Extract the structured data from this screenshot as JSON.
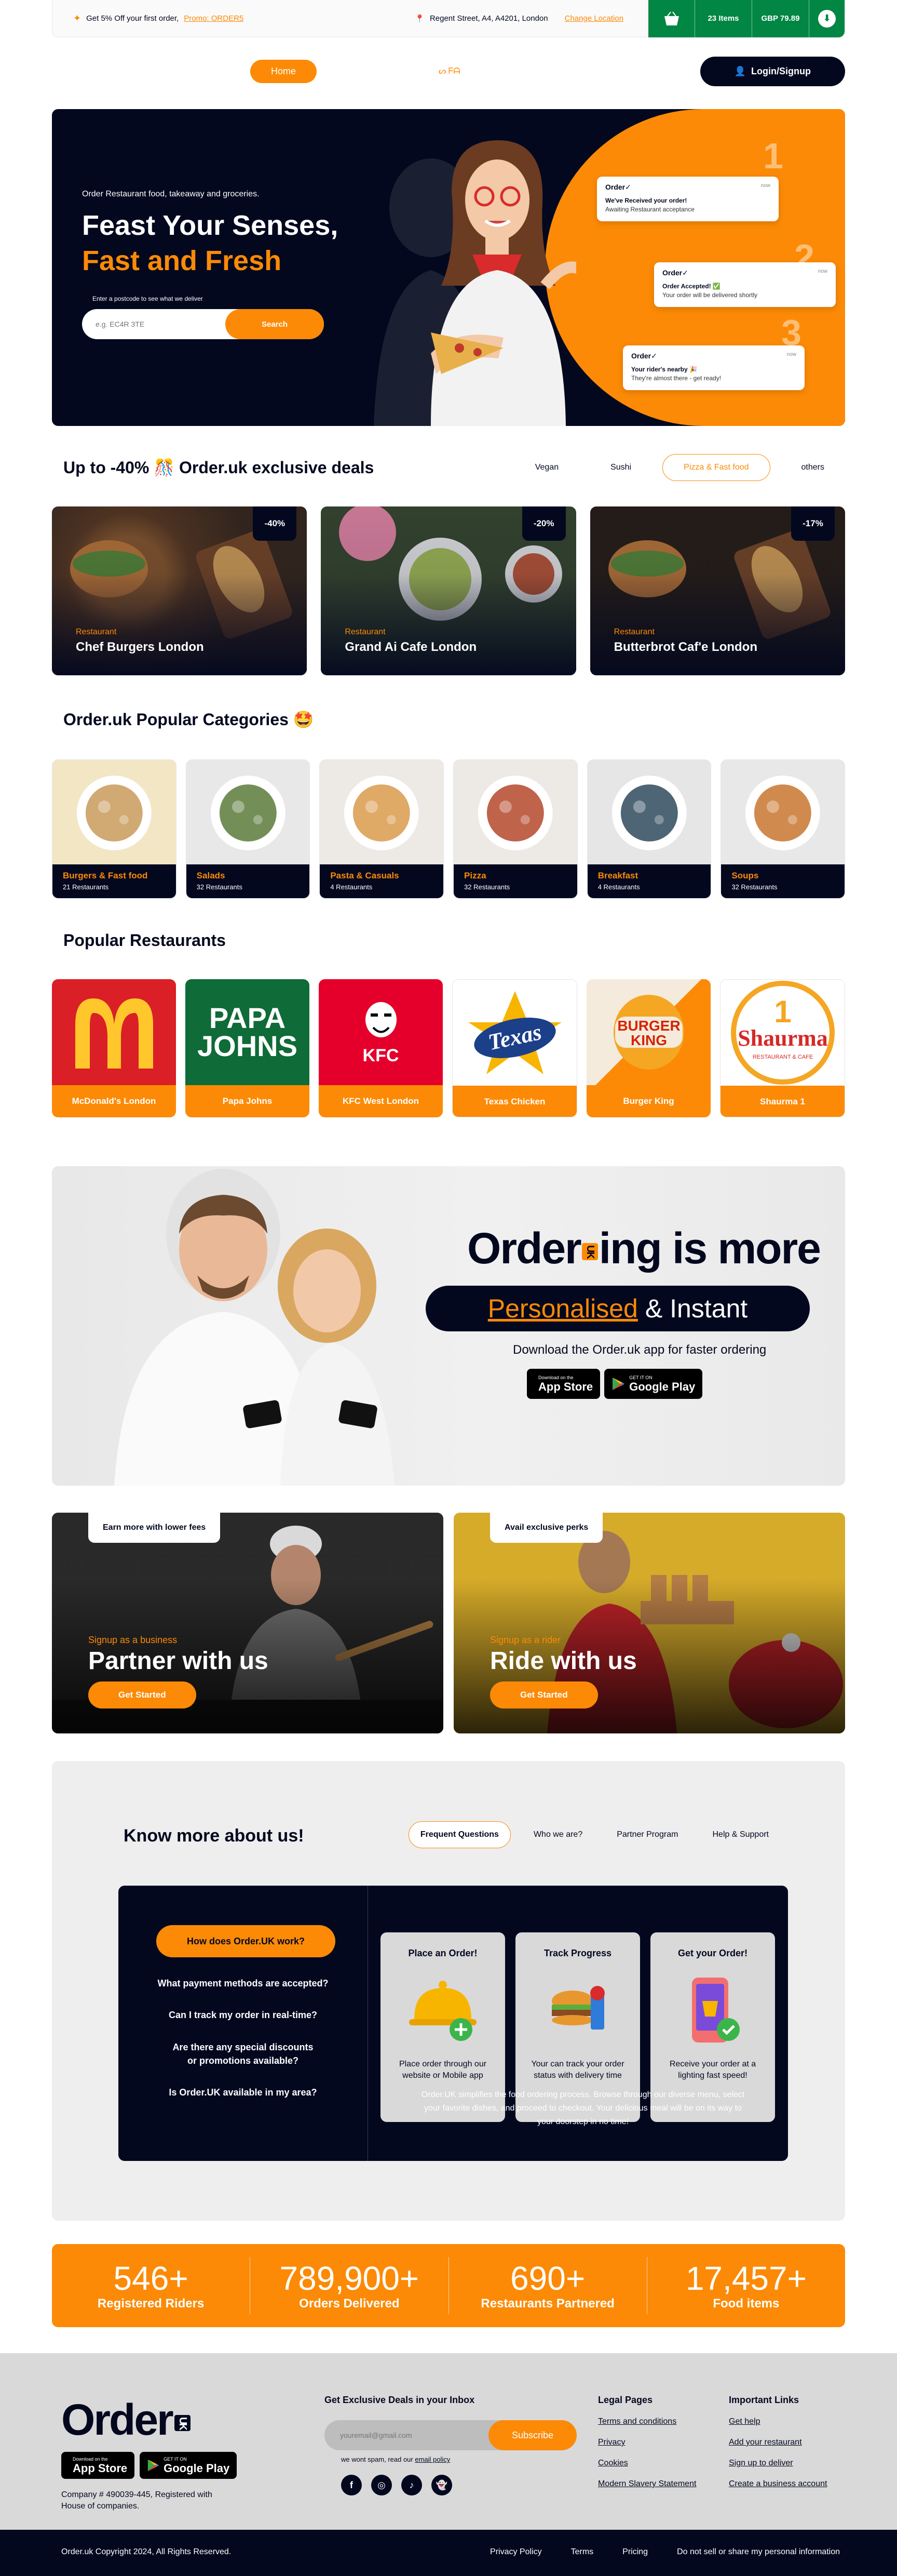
{
  "topbar": {
    "promo_prefix": "Get 5% Off your first order,",
    "promo_code": "Promo: ORDER5",
    "location": "Regent Street, A4, A4201, London",
    "change_location": "Change Location",
    "cart_items": "23 Items",
    "cart_total": "GBP 79.89"
  },
  "nav": {
    "home": "Home",
    "mid": "ᔕ ᖴᗩ",
    "login": "Login/Signup"
  },
  "hero": {
    "tagline": "Order Restaurant food, takeaway and groceries.",
    "title_line1": "Feast Your Senses,",
    "title_line2": "Fast and Fresh",
    "postcode_hint": "Enter a postcode to see what we deliver",
    "search_placeholder": "e.g. EC4R 3TE",
    "search_button": "Search",
    "notifications": [
      {
        "num": "1",
        "brand": "Order✓",
        "time": "now",
        "title": "We've Received your order!",
        "sub": "Awaiting Restaurant acceptance"
      },
      {
        "num": "2",
        "brand": "Order✓",
        "time": "now",
        "title": "Order Accepted! ✅",
        "sub": "Your order will be delivered shortly"
      },
      {
        "num": "3",
        "brand": "Order✓",
        "time": "now",
        "title": "Your rider's nearby 🎉",
        "sub": "They're almost there - get ready!"
      }
    ]
  },
  "deals": {
    "title": "Up to -40% 🎊 Order.uk exclusive deals",
    "filters": [
      "Vegan",
      "Sushi",
      "Pizza & Fast food",
      "others"
    ],
    "active_filter": "Pizza & Fast food",
    "cards": [
      {
        "discount": "-40%",
        "category": "Restaurant",
        "name": "Chef Burgers London"
      },
      {
        "discount": "-20%",
        "category": "Restaurant",
        "name": "Grand Ai Cafe London"
      },
      {
        "discount": "-17%",
        "category": "Restaurant",
        "name": "Butterbrot Caf'e London"
      }
    ]
  },
  "categories": {
    "title": "Order.uk Popular Categories 🤩",
    "items": [
      {
        "name": "Burgers & Fast food",
        "count": "21 Restaurants",
        "bg": "#F2E6C4",
        "plate": "#C89A5A"
      },
      {
        "name": "Salads",
        "count": "32 Restaurants",
        "bg": "#E8E8E8",
        "plate": "#5C7A3A"
      },
      {
        "name": "Pasta & Casuals",
        "count": "4 Restaurants",
        "bg": "#EDEAE6",
        "plate": "#D99A4B"
      },
      {
        "name": "Pizza",
        "count": "32 Restaurants",
        "bg": "#EDEAE6",
        "plate": "#B5482B"
      },
      {
        "name": "Breakfast",
        "count": "4 Restaurants",
        "bg": "#E6E6E6",
        "plate": "#2E4A5C"
      },
      {
        "name": "Soups",
        "count": "32 Restaurants",
        "bg": "#E8E8E8",
        "plate": "#C9752F"
      }
    ]
  },
  "restaurants": {
    "title": "Popular Restaurants",
    "items": [
      {
        "name": "McDonald's London",
        "logo": "M",
        "bg": "#DA1F26",
        "fg": "#FFC72C"
      },
      {
        "name": "Papa Johns",
        "logo": "PAPA JOHNS",
        "bg": "#0F6B37",
        "fg": "#FFFFFF"
      },
      {
        "name": "KFC West London",
        "logo": "KFC",
        "bg": "#E4002B",
        "fg": "#FFFFFF"
      },
      {
        "name": "Texas Chicken",
        "logo": "Texas",
        "bg": "#FFFFFF",
        "fg": "#D71F2A"
      },
      {
        "name": "Burger King",
        "logo": "BURGER KING",
        "bg": "#F5EBDC",
        "fg": "#D62300"
      },
      {
        "name": "Shaurma 1",
        "logo": "Shaurma",
        "bg": "#FFFFFF",
        "fg": "#D62828"
      }
    ]
  },
  "app": {
    "brand_left": "Order",
    "brand_uk": "UK",
    "brand_right": "ing is more",
    "personalised": "Personalised",
    "instant": "& Instant",
    "download": "Download the Order.uk app for faster ordering",
    "appstore_small": "Download on the",
    "appstore_big": "App Store",
    "play_small": "GET IT ON",
    "play_big": "Google Play"
  },
  "partners": [
    {
      "tab": "Earn more with lower fees",
      "sub": "Signup as a business",
      "title": "Partner with us",
      "button": "Get Started"
    },
    {
      "tab": "Avail exclusive perks",
      "sub": "Signup as a rider",
      "title": "Ride with us",
      "button": "Get Started"
    }
  ],
  "know": {
    "title": "Know more about us!",
    "tabs": [
      "Frequent Questions",
      "Who we are?",
      "Partner Program",
      "Help & Support"
    ],
    "questions": [
      "How does Order.UK work?",
      "What payment methods are accepted?",
      "Can I track my order in real-time?",
      "Are there any special discounts or promotions available?",
      "Is Order.UK available in my area?"
    ],
    "cards": [
      {
        "title": "Place an Order!",
        "desc": "Place order through our website or Mobile app"
      },
      {
        "title": "Track Progress",
        "desc": "Your can track your order status with delivery time"
      },
      {
        "title": "Get your Order!",
        "desc": "Receive your order at a lighting fast speed!"
      }
    ],
    "paragraph": "Order.UK simplifies the food ordering process. Browse through our diverse menu, select your favorite dishes, and proceed to checkout. Your delicious meal will be on its way to your doorstep in no time!"
  },
  "stats": [
    {
      "num": "546+",
      "label": "Registered Riders"
    },
    {
      "num": "789,900+",
      "label": "Orders Delivered"
    },
    {
      "num": "690+",
      "label": "Restaurants Partnered"
    },
    {
      "num": "17,457+",
      "label": "Food items"
    }
  ],
  "footer": {
    "logo": "Order",
    "logo_uk": "UK",
    "company": "Company # 490039-445, Registered with House of companies.",
    "deals_title": "Get Exclusive Deals in your Inbox",
    "email_placeholder": "youremail@gmail.com",
    "subscribe": "Subscribe",
    "spam_text": "we wont spam, read our",
    "spam_link": "email policy",
    "social": [
      "f",
      "◎",
      "♪",
      "👻"
    ],
    "legal_title": "Legal Pages",
    "legal": [
      "Terms and conditions",
      "Privacy",
      "Cookies",
      "Modern Slavery Statement"
    ],
    "important_title": "Important Links",
    "important": [
      "Get help",
      "Add your restaurant",
      "Sign up to deliver",
      "Create a business account"
    ],
    "copyright": "Order.uk Copyright 2024, All Rights Reserved.",
    "bottom_links": [
      "Privacy Policy",
      "Terms",
      "Pricing",
      "Do not sell or share my personal information"
    ]
  }
}
